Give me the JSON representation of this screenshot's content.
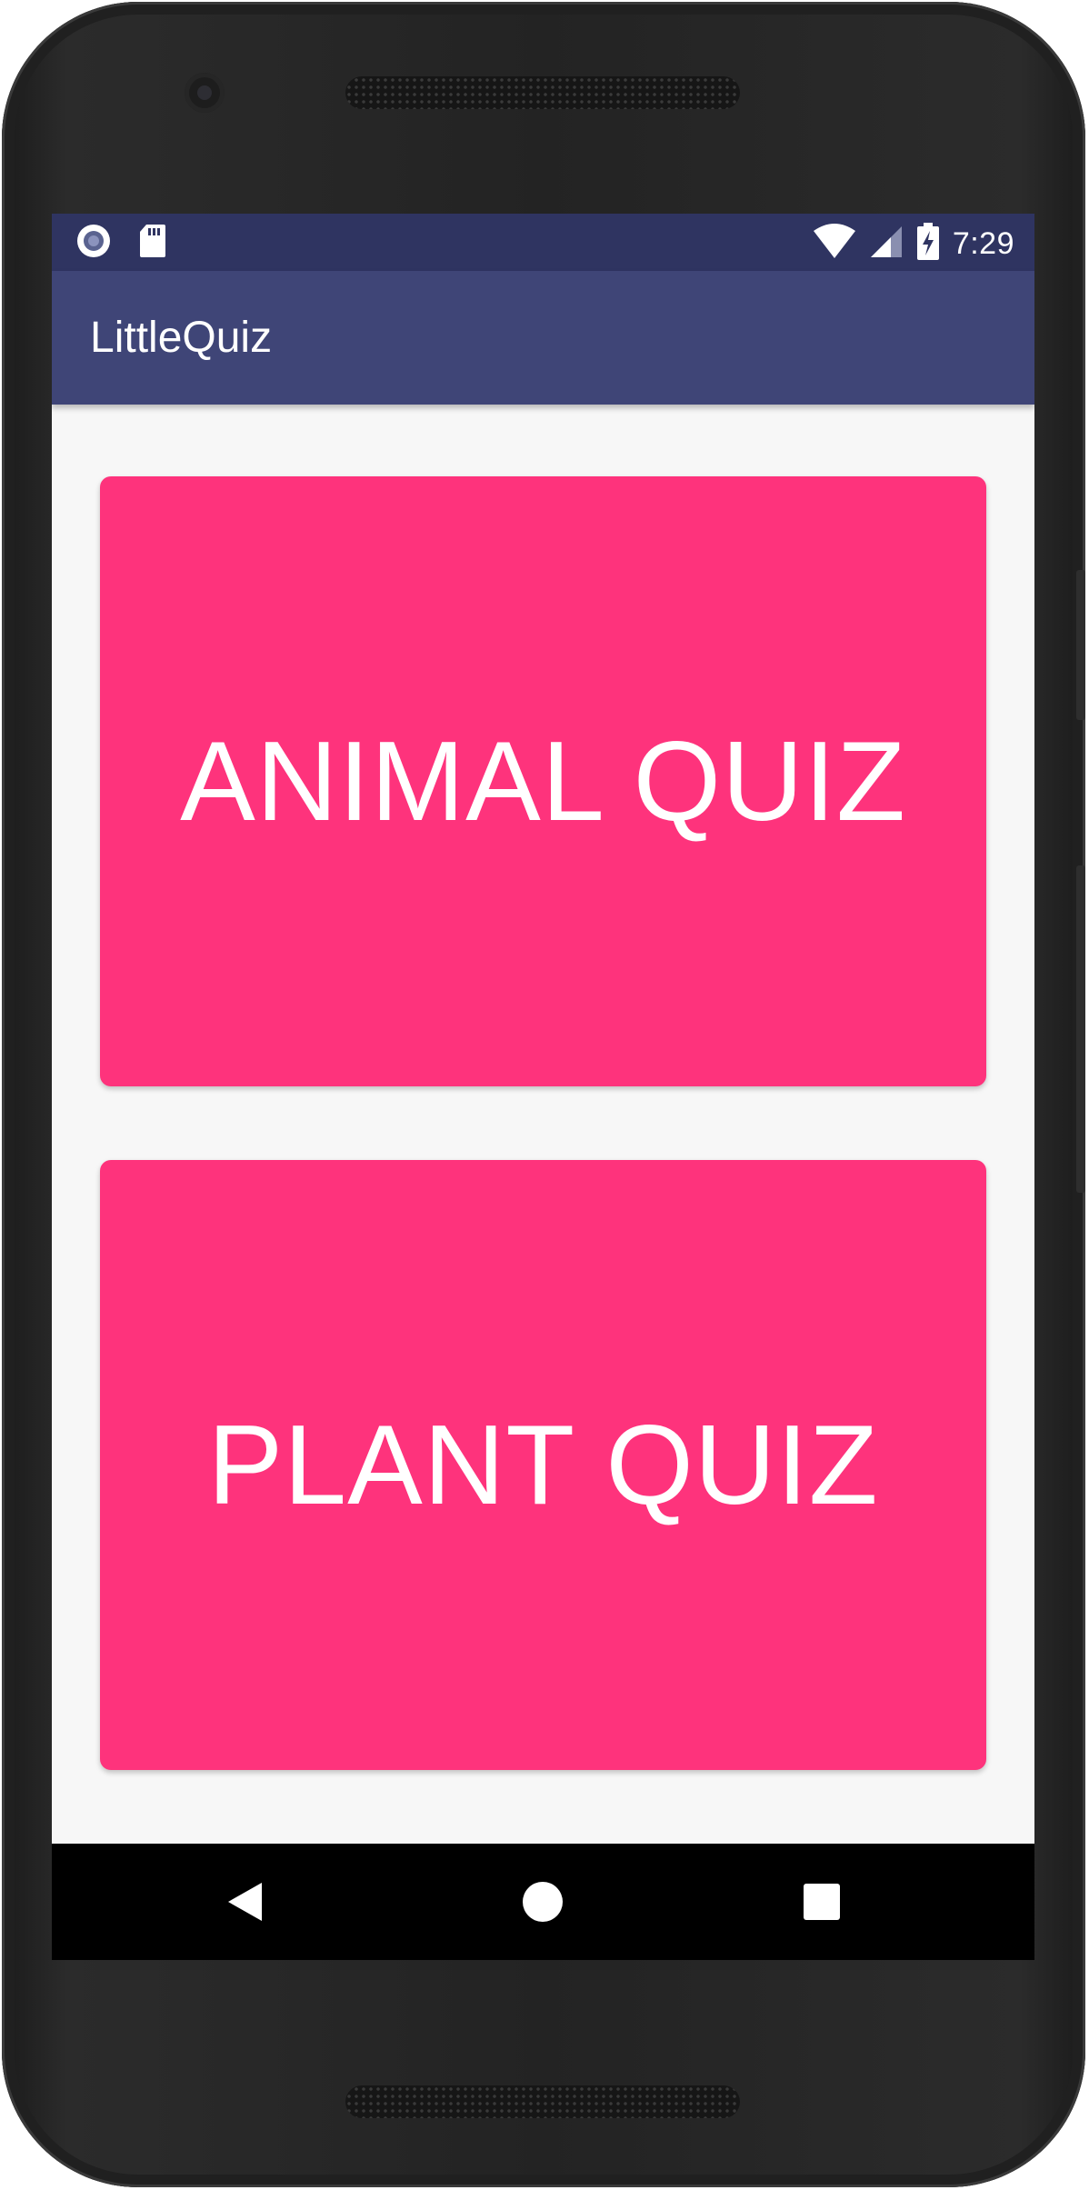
{
  "status_bar": {
    "time": "7:29",
    "left_icons": [
      "notification-record-icon",
      "sd-card-icon"
    ],
    "right_icons": [
      "wifi-icon",
      "cell-signal-icon",
      "battery-charging-icon"
    ]
  },
  "app_bar": {
    "title": "LittleQuiz"
  },
  "main": {
    "animal_quiz_label": "ANIMAL QUIZ",
    "plant_quiz_label": "PLANT QUIZ"
  },
  "nav_bar": {
    "icons": [
      "back-icon",
      "home-icon",
      "recents-icon"
    ]
  },
  "colors": {
    "status_bar": "#2f3461",
    "app_bar": "#3f4577",
    "quiz_card": "#fe337c",
    "background": "#f7f7f7",
    "nav_bar": "#000000"
  }
}
